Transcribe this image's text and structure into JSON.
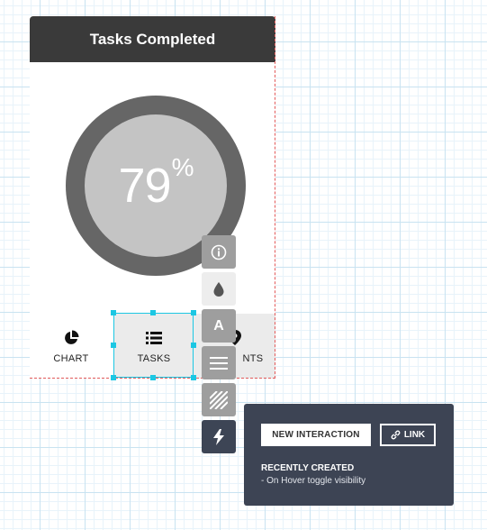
{
  "widget": {
    "title": "Tasks Completed",
    "percent_value": "79",
    "percent_sign": "%",
    "tabs": [
      {
        "label": "CHART",
        "icon": "pie-chart-icon"
      },
      {
        "label": "TASKS",
        "icon": "list-icon"
      },
      {
        "label": "NTS",
        "icon": "location-pin-icon"
      }
    ]
  },
  "toolbar": {
    "buttons": [
      {
        "icon": "info-icon"
      },
      {
        "icon": "color-drop-icon"
      },
      {
        "icon": "text-icon",
        "glyph": "A"
      },
      {
        "icon": "lines-icon"
      },
      {
        "icon": "hatch-pattern-icon"
      },
      {
        "icon": "lightning-icon"
      }
    ]
  },
  "popup": {
    "new_interaction_label": "NEW INTERACTION",
    "link_label": "LINK",
    "recent_heading": "RECENTLY CREATED",
    "recent_item": "- On Hover toggle visibility"
  },
  "colors": {
    "header": "#3a3a3a",
    "donut_ring": "#666666",
    "donut_inner": "#c4c4c4",
    "selection": "#1cc7e3",
    "popup_bg": "#3d4454",
    "frame_dash": "#e25a5a"
  }
}
